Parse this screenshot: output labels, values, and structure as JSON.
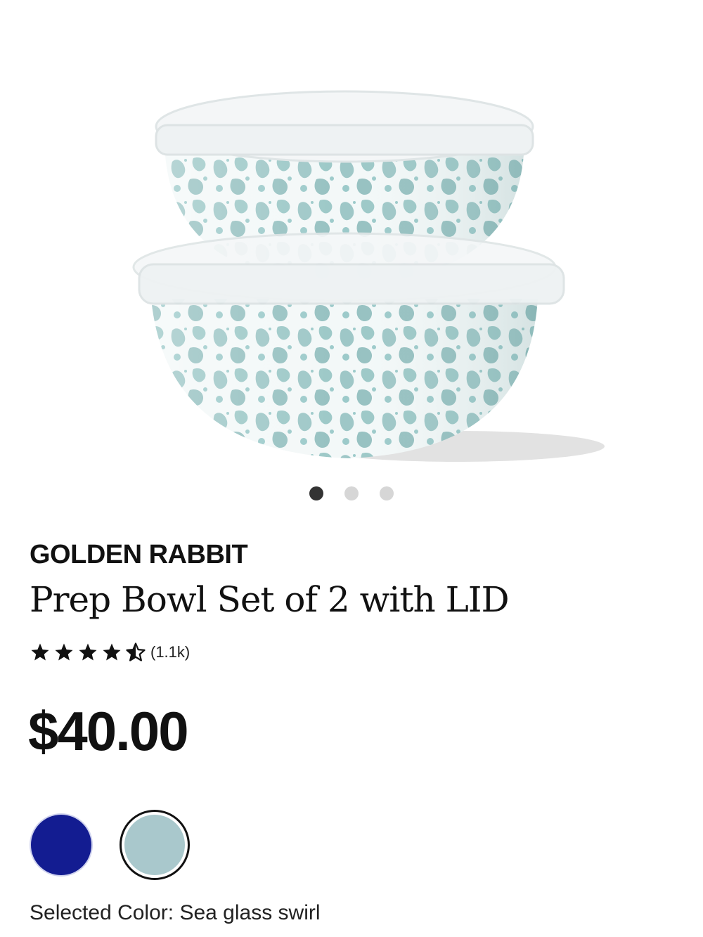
{
  "gallery": {
    "image_label": "bowl-set-image",
    "dots": [
      {
        "name": "gallery-dot-1",
        "active": true
      },
      {
        "name": "gallery-dot-2",
        "active": false
      },
      {
        "name": "gallery-dot-3",
        "active": false
      }
    ]
  },
  "product": {
    "brand": "GOLDEN RABBIT",
    "title": "Prep Bowl Set of 2 with LID",
    "rating": 4.5,
    "rating_max": 5,
    "review_count": "(1.1k)",
    "price": "$40.00"
  },
  "colors": {
    "swatches": [
      {
        "name": "cobalt-blue",
        "hex": "#131c91",
        "selected": false
      },
      {
        "name": "sea-glass-swirl",
        "hex": "#a9c8cc",
        "selected": true
      }
    ],
    "selected_label": "Selected Color: Sea glass swirl"
  },
  "icons": {
    "star": "star-icon",
    "half_star": "half-star-icon"
  }
}
